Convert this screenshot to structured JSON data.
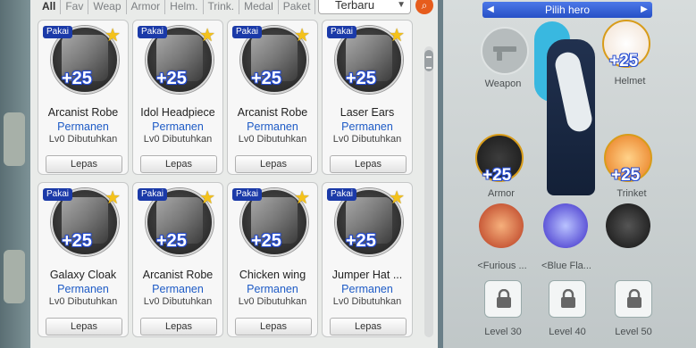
{
  "filters": [
    "All",
    "Fav",
    "Weap",
    "Armor",
    "Helm.",
    "Trink.",
    "Medal",
    "Paket"
  ],
  "sort": {
    "value": "Terbaru"
  },
  "items": [
    {
      "badge": "Pakai",
      "plus": "+25",
      "name": "Arcanist Robe",
      "duration": "Permanen",
      "req": "Lv0 Dibutuhkan",
      "action": "Lepas"
    },
    {
      "badge": "Pakai",
      "plus": "+25",
      "name": "Idol Headpiece",
      "duration": "Permanen",
      "req": "Lv0 Dibutuhkan",
      "action": "Lepas"
    },
    {
      "badge": "Pakai",
      "plus": "+25",
      "name": "Arcanist Robe",
      "duration": "Permanen",
      "req": "Lv0 Dibutuhkan",
      "action": "Lepas"
    },
    {
      "badge": "Pakai",
      "plus": "+25",
      "name": "Laser Ears",
      "duration": "Permanen",
      "req": "Lv0 Dibutuhkan",
      "action": "Lepas"
    },
    {
      "badge": "Pakai",
      "plus": "+25",
      "name": "Galaxy Cloak",
      "duration": "Permanen",
      "req": "Lv0 Dibutuhkan",
      "action": "Lepas"
    },
    {
      "badge": "Pakai",
      "plus": "+25",
      "name": "Arcanist Robe",
      "duration": "Permanen",
      "req": "Lv0 Dibutuhkan",
      "action": "Lepas"
    },
    {
      "badge": "Pakai",
      "plus": "+25",
      "name": "Chicken wing",
      "duration": "Permanen",
      "req": "Lv0 Dibutuhkan",
      "action": "Lepas"
    },
    {
      "badge": "Pakai",
      "plus": "+25",
      "name": "Jumper Hat ...",
      "duration": "Permanen",
      "req": "Lv0 Dibutuhkan",
      "action": "Lepas"
    }
  ],
  "hero": {
    "title": "Pilih hero",
    "slots": {
      "weapon": {
        "label": "Weapon"
      },
      "helmet": {
        "label": "Helmet",
        "plus": "+25"
      },
      "armor": {
        "label": "Armor",
        "plus": "+25"
      },
      "trinket": {
        "label": "Trinket",
        "plus": "+25"
      }
    },
    "pets": [
      {
        "label": "<Furious ..."
      },
      {
        "label": "<Blue Fla..."
      },
      {
        "label": ""
      }
    ],
    "locks": [
      {
        "label": "Level 30"
      },
      {
        "label": "Level 40"
      },
      {
        "label": "Level 50"
      }
    ]
  },
  "colors": {
    "accent": "#244bd1",
    "badge": "#1b3aa8",
    "star": "#f4c21b",
    "sortButton": "#e65c1c"
  }
}
